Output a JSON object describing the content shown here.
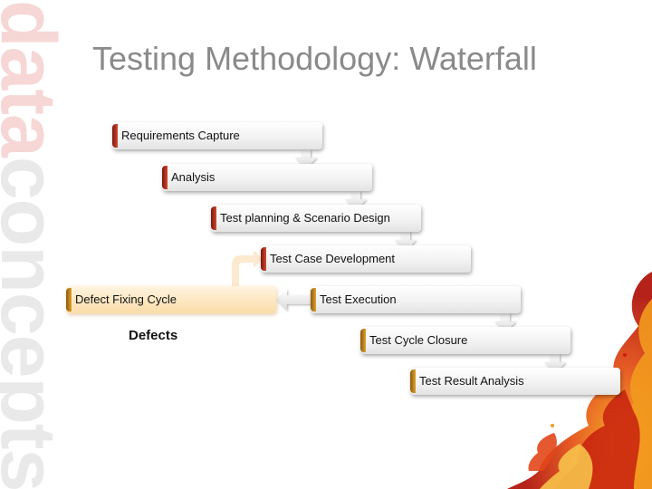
{
  "slide": {
    "title": "Testing Methodology: Waterfall",
    "logo_part1": "data",
    "logo_part2": "concepts"
  },
  "flow": {
    "steps": [
      {
        "label": "Requirements Capture",
        "accent": "red"
      },
      {
        "label": "Analysis",
        "accent": "red"
      },
      {
        "label": "Test planning & Scenario Design",
        "accent": "red"
      },
      {
        "label": "Test Case Development",
        "accent": "red"
      },
      {
        "label": "Test Execution",
        "accent": "gold"
      },
      {
        "label": "Test Cycle Closure",
        "accent": "gold"
      },
      {
        "label": "Test Result Analysis",
        "accent": "gold"
      }
    ],
    "defect_box": "Defect Fixing Cycle",
    "defects_label": "Defects"
  }
}
